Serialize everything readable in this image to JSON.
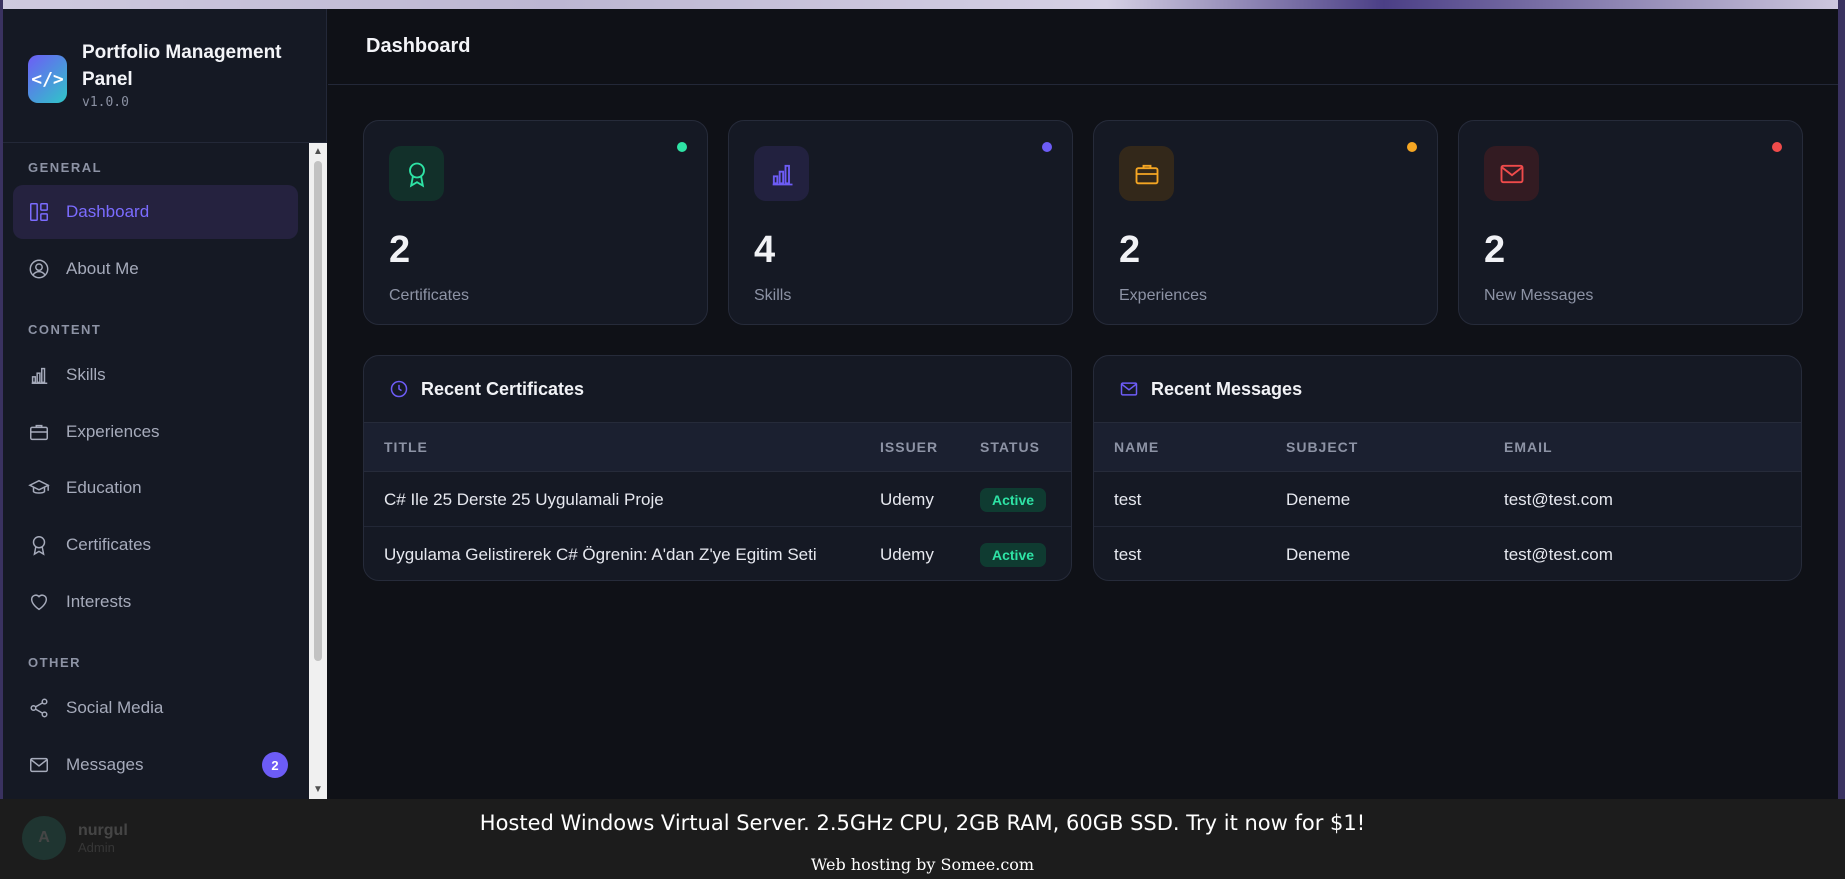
{
  "brand": {
    "title": "Portfolio Management Panel",
    "version": "v1.0.0",
    "logo_glyph": "</>"
  },
  "header": {
    "title": "Dashboard"
  },
  "sidebar": {
    "sections": {
      "general": "GENERAL",
      "content": "CONTENT",
      "other": "OTHER"
    },
    "items": [
      {
        "label": "Dashboard",
        "icon": "dashboard-icon",
        "active": true
      },
      {
        "label": "About Me",
        "icon": "user-circle-icon"
      },
      {
        "label": "Skills",
        "icon": "bar-chart-icon"
      },
      {
        "label": "Experiences",
        "icon": "briefcase-icon"
      },
      {
        "label": "Education",
        "icon": "graduation-cap-icon"
      },
      {
        "label": "Certificates",
        "icon": "award-icon"
      },
      {
        "label": "Interests",
        "icon": "heart-icon"
      },
      {
        "label": "Social Media",
        "icon": "share-icon"
      },
      {
        "label": "Messages",
        "icon": "mail-icon",
        "badge": "2"
      }
    ]
  },
  "stats": [
    {
      "value": "2",
      "label": "Certificates",
      "icon": "award-icon",
      "color": "#2ee3a5"
    },
    {
      "value": "4",
      "label": "Skills",
      "icon": "bar-chart-icon",
      "color": "#6d5cf6"
    },
    {
      "value": "2",
      "label": "Experiences",
      "icon": "briefcase-icon",
      "color": "#f5a623"
    },
    {
      "value": "2",
      "label": "New Messages",
      "icon": "mail-icon",
      "color": "#ef4b4b"
    }
  ],
  "recent_certificates": {
    "title": "Recent Certificates",
    "columns": [
      "TITLE",
      "ISSUER",
      "STATUS"
    ],
    "rows": [
      {
        "title": "C# Ile 25 Derste 25 Uygulamali Proje",
        "issuer": "Udemy",
        "status": "Active"
      },
      {
        "title": "Uygulama Gelistirerek C# Ögrenin: A'dan Z'ye Egitim Seti",
        "issuer": "Udemy",
        "status": "Active"
      }
    ]
  },
  "recent_messages": {
    "title": "Recent Messages",
    "columns": [
      "NAME",
      "SUBJECT",
      "EMAIL"
    ],
    "rows": [
      {
        "name": "test",
        "subject": "Deneme",
        "email": "test@test.com"
      },
      {
        "name": "test",
        "subject": "Deneme",
        "email": "test@test.com"
      }
    ]
  },
  "user": {
    "avatar": "A",
    "name": "nurgul",
    "role": "Admin"
  },
  "ad": {
    "main": "Hosted Windows Virtual Server. 2.5GHz CPU, 2GB RAM, 60GB SSD. Try it now for $1!",
    "sub": "Web hosting by Somee.com"
  },
  "colors": {
    "accent": "#6d5cf6",
    "background": "#0f1117",
    "card": "#151924",
    "success": "#2ee3a5"
  }
}
